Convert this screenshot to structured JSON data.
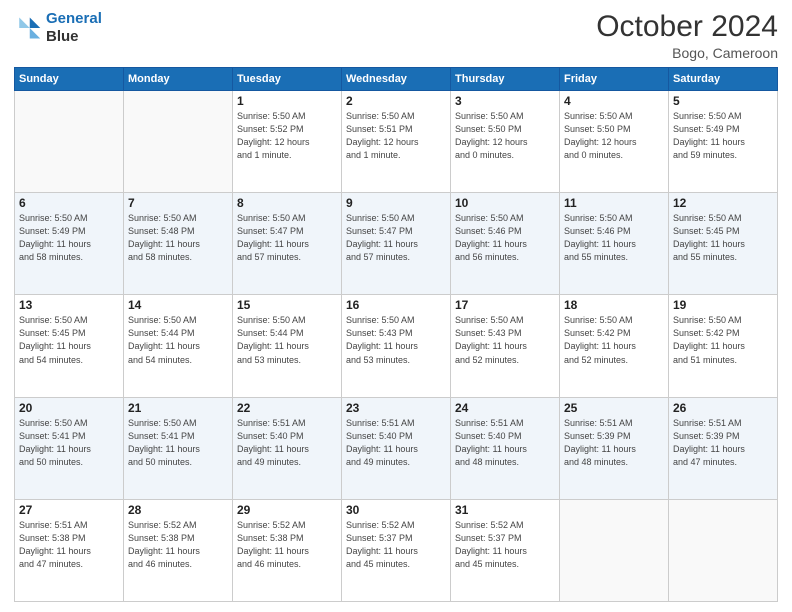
{
  "header": {
    "logo_line1": "General",
    "logo_line2": "Blue",
    "month_title": "October 2024",
    "location": "Bogo, Cameroon"
  },
  "weekdays": [
    "Sunday",
    "Monday",
    "Tuesday",
    "Wednesday",
    "Thursday",
    "Friday",
    "Saturday"
  ],
  "weeks": [
    [
      {
        "day": "",
        "info": ""
      },
      {
        "day": "",
        "info": ""
      },
      {
        "day": "1",
        "info": "Sunrise: 5:50 AM\nSunset: 5:52 PM\nDaylight: 12 hours\nand 1 minute."
      },
      {
        "day": "2",
        "info": "Sunrise: 5:50 AM\nSunset: 5:51 PM\nDaylight: 12 hours\nand 1 minute."
      },
      {
        "day": "3",
        "info": "Sunrise: 5:50 AM\nSunset: 5:50 PM\nDaylight: 12 hours\nand 0 minutes."
      },
      {
        "day": "4",
        "info": "Sunrise: 5:50 AM\nSunset: 5:50 PM\nDaylight: 12 hours\nand 0 minutes."
      },
      {
        "day": "5",
        "info": "Sunrise: 5:50 AM\nSunset: 5:49 PM\nDaylight: 11 hours\nand 59 minutes."
      }
    ],
    [
      {
        "day": "6",
        "info": "Sunrise: 5:50 AM\nSunset: 5:49 PM\nDaylight: 11 hours\nand 58 minutes."
      },
      {
        "day": "7",
        "info": "Sunrise: 5:50 AM\nSunset: 5:48 PM\nDaylight: 11 hours\nand 58 minutes."
      },
      {
        "day": "8",
        "info": "Sunrise: 5:50 AM\nSunset: 5:47 PM\nDaylight: 11 hours\nand 57 minutes."
      },
      {
        "day": "9",
        "info": "Sunrise: 5:50 AM\nSunset: 5:47 PM\nDaylight: 11 hours\nand 57 minutes."
      },
      {
        "day": "10",
        "info": "Sunrise: 5:50 AM\nSunset: 5:46 PM\nDaylight: 11 hours\nand 56 minutes."
      },
      {
        "day": "11",
        "info": "Sunrise: 5:50 AM\nSunset: 5:46 PM\nDaylight: 11 hours\nand 55 minutes."
      },
      {
        "day": "12",
        "info": "Sunrise: 5:50 AM\nSunset: 5:45 PM\nDaylight: 11 hours\nand 55 minutes."
      }
    ],
    [
      {
        "day": "13",
        "info": "Sunrise: 5:50 AM\nSunset: 5:45 PM\nDaylight: 11 hours\nand 54 minutes."
      },
      {
        "day": "14",
        "info": "Sunrise: 5:50 AM\nSunset: 5:44 PM\nDaylight: 11 hours\nand 54 minutes."
      },
      {
        "day": "15",
        "info": "Sunrise: 5:50 AM\nSunset: 5:44 PM\nDaylight: 11 hours\nand 53 minutes."
      },
      {
        "day": "16",
        "info": "Sunrise: 5:50 AM\nSunset: 5:43 PM\nDaylight: 11 hours\nand 53 minutes."
      },
      {
        "day": "17",
        "info": "Sunrise: 5:50 AM\nSunset: 5:43 PM\nDaylight: 11 hours\nand 52 minutes."
      },
      {
        "day": "18",
        "info": "Sunrise: 5:50 AM\nSunset: 5:42 PM\nDaylight: 11 hours\nand 52 minutes."
      },
      {
        "day": "19",
        "info": "Sunrise: 5:50 AM\nSunset: 5:42 PM\nDaylight: 11 hours\nand 51 minutes."
      }
    ],
    [
      {
        "day": "20",
        "info": "Sunrise: 5:50 AM\nSunset: 5:41 PM\nDaylight: 11 hours\nand 50 minutes."
      },
      {
        "day": "21",
        "info": "Sunrise: 5:50 AM\nSunset: 5:41 PM\nDaylight: 11 hours\nand 50 minutes."
      },
      {
        "day": "22",
        "info": "Sunrise: 5:51 AM\nSunset: 5:40 PM\nDaylight: 11 hours\nand 49 minutes."
      },
      {
        "day": "23",
        "info": "Sunrise: 5:51 AM\nSunset: 5:40 PM\nDaylight: 11 hours\nand 49 minutes."
      },
      {
        "day": "24",
        "info": "Sunrise: 5:51 AM\nSunset: 5:40 PM\nDaylight: 11 hours\nand 48 minutes."
      },
      {
        "day": "25",
        "info": "Sunrise: 5:51 AM\nSunset: 5:39 PM\nDaylight: 11 hours\nand 48 minutes."
      },
      {
        "day": "26",
        "info": "Sunrise: 5:51 AM\nSunset: 5:39 PM\nDaylight: 11 hours\nand 47 minutes."
      }
    ],
    [
      {
        "day": "27",
        "info": "Sunrise: 5:51 AM\nSunset: 5:38 PM\nDaylight: 11 hours\nand 47 minutes."
      },
      {
        "day": "28",
        "info": "Sunrise: 5:52 AM\nSunset: 5:38 PM\nDaylight: 11 hours\nand 46 minutes."
      },
      {
        "day": "29",
        "info": "Sunrise: 5:52 AM\nSunset: 5:38 PM\nDaylight: 11 hours\nand 46 minutes."
      },
      {
        "day": "30",
        "info": "Sunrise: 5:52 AM\nSunset: 5:37 PM\nDaylight: 11 hours\nand 45 minutes."
      },
      {
        "day": "31",
        "info": "Sunrise: 5:52 AM\nSunset: 5:37 PM\nDaylight: 11 hours\nand 45 minutes."
      },
      {
        "day": "",
        "info": ""
      },
      {
        "day": "",
        "info": ""
      }
    ]
  ],
  "accent_color": "#1a6eb5"
}
